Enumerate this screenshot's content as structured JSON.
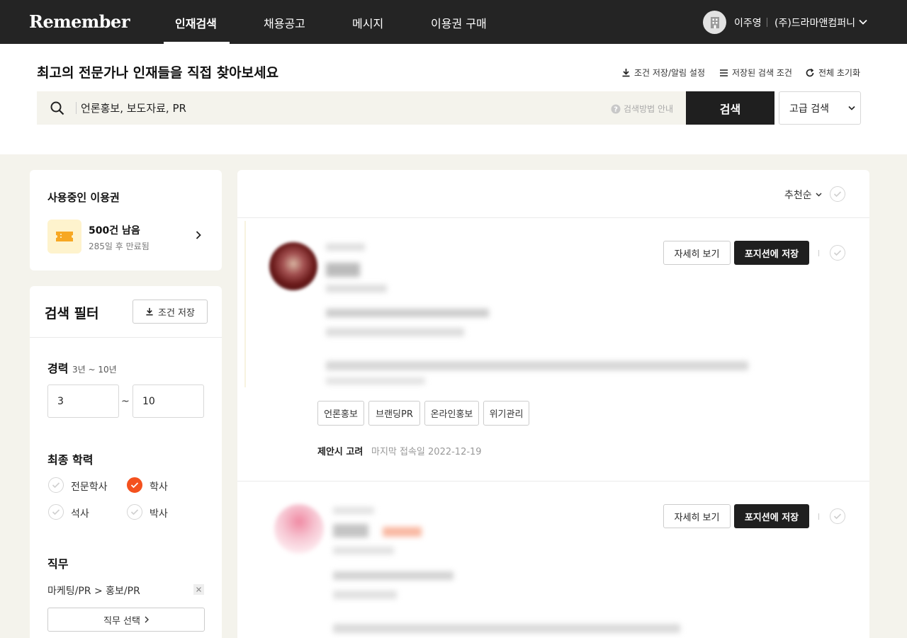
{
  "nav": {
    "logo": "Remember",
    "items": [
      "인재검색",
      "채용공고",
      "메시지",
      "이용권 구매"
    ],
    "user_name": "이주영",
    "company": "(주)드라마앤컴퍼니"
  },
  "search": {
    "headline": "최고의 전문가나 인재들을 직접 찾아보세요",
    "save_alert_label": "조건 저장/알림 설정",
    "saved_conditions_label": "저장된 검색 조건",
    "reset_label": "전체 초기화",
    "query": "언론홍보, 보도자료, PR",
    "howto_label": "검색방법 안내",
    "button_label": "검색",
    "advanced_label": "고급 검색"
  },
  "pass": {
    "title": "사용중인 이용권",
    "remaining": "500건 남음",
    "expiry": "285일 후 만료됨"
  },
  "filter": {
    "title": "검색 필터",
    "save_label": "조건 저장",
    "career_label": "경력",
    "career_range": "3년 ~ 10년",
    "career_min": "3",
    "career_max": "10",
    "career_sep": "~",
    "education_label": "최종 학력",
    "education_options": [
      {
        "label": "전문학사",
        "checked": false
      },
      {
        "label": "학사",
        "checked": true
      },
      {
        "label": "석사",
        "checked": false
      },
      {
        "label": "박사",
        "checked": false
      }
    ],
    "job_label": "직무",
    "job_value": "마케팅/PR > 홍보/PR",
    "job_select_label": "직무 선택"
  },
  "results": {
    "sort_label": "추천순",
    "detail_label": "자세히 보기",
    "save_position_label": "포지션에 저장",
    "candidates": [
      {
        "tags": [
          "언론홍보",
          "브랜딩PR",
          "온라인홍보",
          "위기관리"
        ],
        "status": "제안시 고려",
        "last_access": "마지막 접속일 2022-12-19"
      }
    ]
  },
  "colors": {
    "accent": "#f4511e",
    "dark": "#1f1f1f",
    "background": "#f4f3ec"
  }
}
